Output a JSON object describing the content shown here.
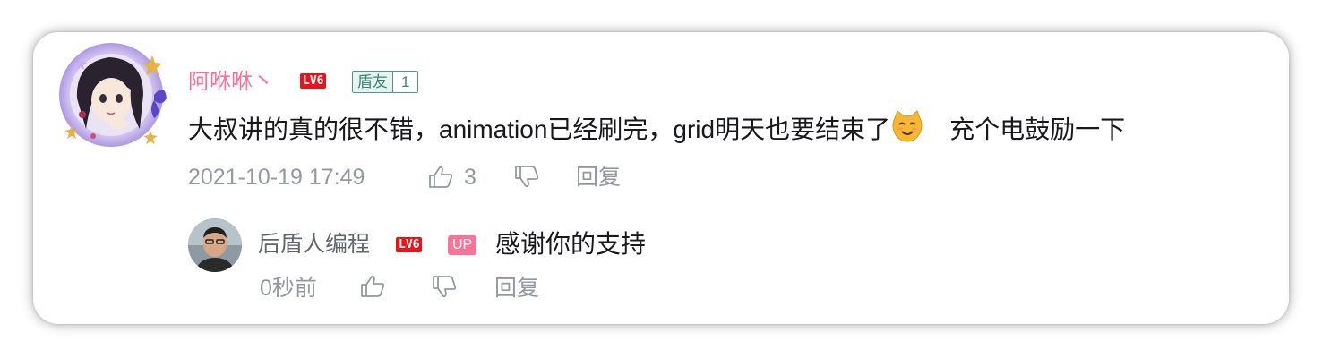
{
  "comment": {
    "username": "阿咻咻丶",
    "level_badge": "LV6",
    "fan_badge": {
      "name": "盾友",
      "level": "1"
    },
    "content_main": "大叔讲的真的很不错，animation已经刷完，grid明天也要结束了",
    "emoji": "cat-face-emoji",
    "content_tail": "充个电鼓励一下",
    "date": "2021-10-19 17:49",
    "like_count": "3",
    "reply_label": "回复"
  },
  "reply": {
    "username": "后盾人编程",
    "level_badge": "LV6",
    "up_badge": "UP",
    "content": "感谢你的支持",
    "time": "0秒前",
    "reply_label": "回复"
  },
  "colors": {
    "username_vip": "#fb7299",
    "meta_gray": "#9499a0",
    "level_red": "#e8141b",
    "fan_green": "#4a9a87",
    "text": "#18191c"
  }
}
